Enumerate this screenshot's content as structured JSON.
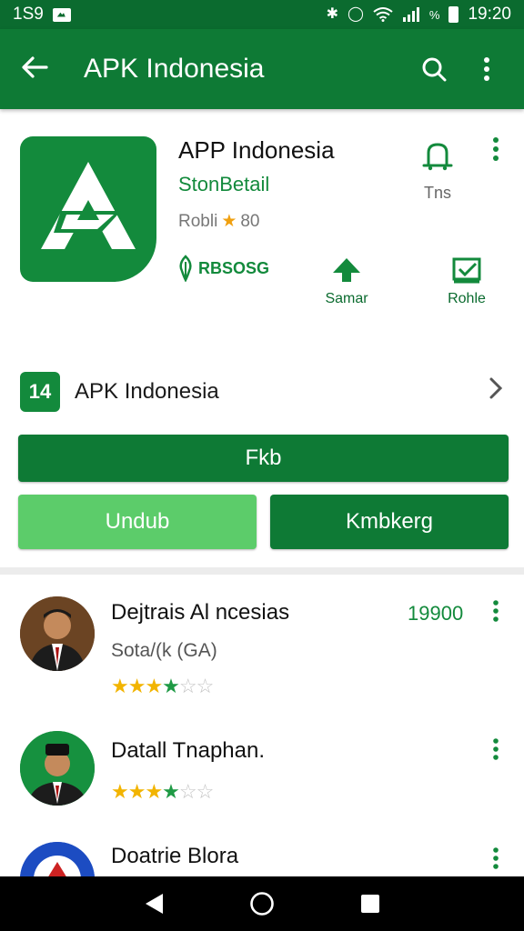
{
  "status": {
    "time_left": "1S9",
    "time_right": "19:20"
  },
  "app_bar": {
    "title": "APK Indonesia"
  },
  "app": {
    "name": "APP Indonesia",
    "developer": "StonBetail",
    "rating_label": "Robli",
    "rating_value": "80",
    "wishlist_label": "Tns",
    "stats": [
      {
        "label": "RBSOSG"
      },
      {
        "label": "Samar"
      },
      {
        "label": "Rohle"
      }
    ]
  },
  "link_row": {
    "label": "APK Indonesia",
    "icon_text": "14"
  },
  "buttons": {
    "main": "Fkb",
    "left": "Undub",
    "right": "Kmbkerg"
  },
  "list": [
    {
      "title": "Dejtrais Al ncesias",
      "subtitle": "Sota/(k (GA)",
      "price": "19900",
      "stars": "★★★★☆☆"
    },
    {
      "title": "Datall Tnaphan.",
      "subtitle": "",
      "price": "",
      "stars": "★★★★☆☆"
    },
    {
      "title": "Doatrie Blora",
      "subtitle": "",
      "price": "",
      "stars": ""
    }
  ],
  "colors": {
    "primary": "#0e7a35",
    "status": "#0b6b2f",
    "accent_light": "#5ccc6a",
    "star": "#f2b400"
  }
}
